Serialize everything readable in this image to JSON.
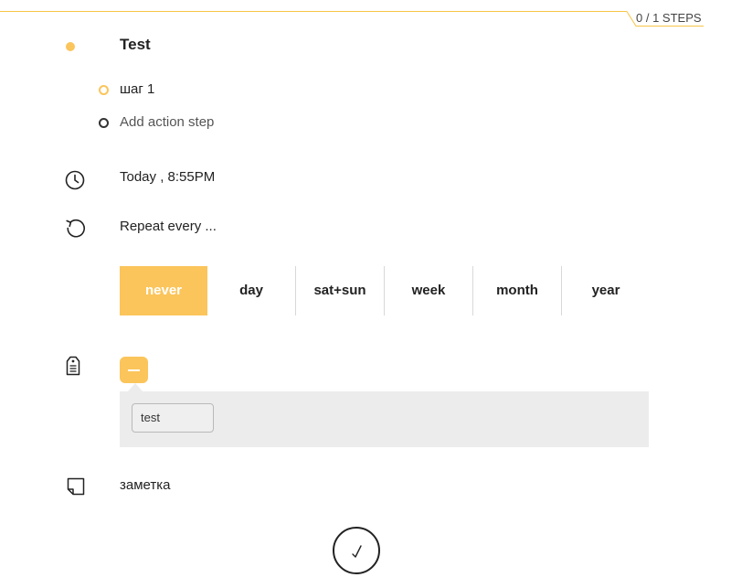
{
  "header": {
    "steps_progress": "0 / 1 STEPS",
    "accent_color": "#fbc55b"
  },
  "task": {
    "title": "Test",
    "steps": [
      {
        "label": "шаг 1",
        "icon": "step-ring-icon"
      },
      {
        "label": "Add action step",
        "icon": "add-step-ring-icon"
      }
    ]
  },
  "due": {
    "icon": "clock-icon",
    "text": "Today , 8:55PM"
  },
  "repeat": {
    "icon": "repeat-icon",
    "text": "Repeat every ...",
    "options": [
      "never",
      "day",
      "sat+sun",
      "week",
      "month",
      "year"
    ],
    "selected": "never"
  },
  "tags": {
    "icon": "tag-icon",
    "toggle_label": "—",
    "items": [
      "test"
    ]
  },
  "note": {
    "icon": "note-icon",
    "text": "заметка"
  },
  "done": {
    "icon": "checkmark-icon"
  }
}
